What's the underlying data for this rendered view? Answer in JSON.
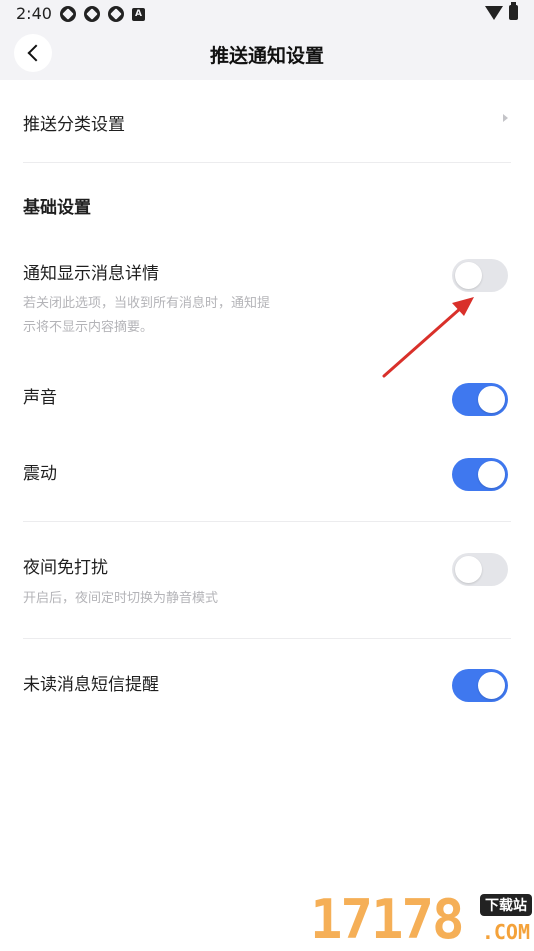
{
  "status_bar": {
    "time": "2:40",
    "left_icons": [
      "app-icon",
      "app-icon",
      "app-icon",
      "a-icon"
    ],
    "right_icons": [
      "wifi-icon",
      "battery-icon"
    ],
    "a_glyph": "A"
  },
  "header": {
    "title": "推送通知设置",
    "back_icon": "back-chevron-icon"
  },
  "rows": {
    "push_category": {
      "label": "推送分类设置"
    },
    "basic_section": {
      "title": "基础设置"
    },
    "show_details": {
      "label": "通知显示消息详情",
      "desc_line1": "若关闭此选项，当收到所有消息时，通知提",
      "desc_line2": "示将不显示内容摘要。",
      "enabled": false
    },
    "sound": {
      "label": "声音",
      "enabled": true
    },
    "vibrate": {
      "label": "震动",
      "enabled": true
    },
    "dnd": {
      "label": "夜间免打扰",
      "desc": "开启后，夜间定时切换为静音模式",
      "enabled": false
    },
    "sms_reminder": {
      "label": "未读消息短信提醒",
      "enabled": true
    }
  },
  "colors": {
    "accent": "#3f78ef",
    "toggle_off": "#e4e5e9",
    "annotation_arrow": "#d9302a"
  },
  "watermark": {
    "digits": "17178",
    "tag": "下载站",
    "suffix": ".COM"
  }
}
